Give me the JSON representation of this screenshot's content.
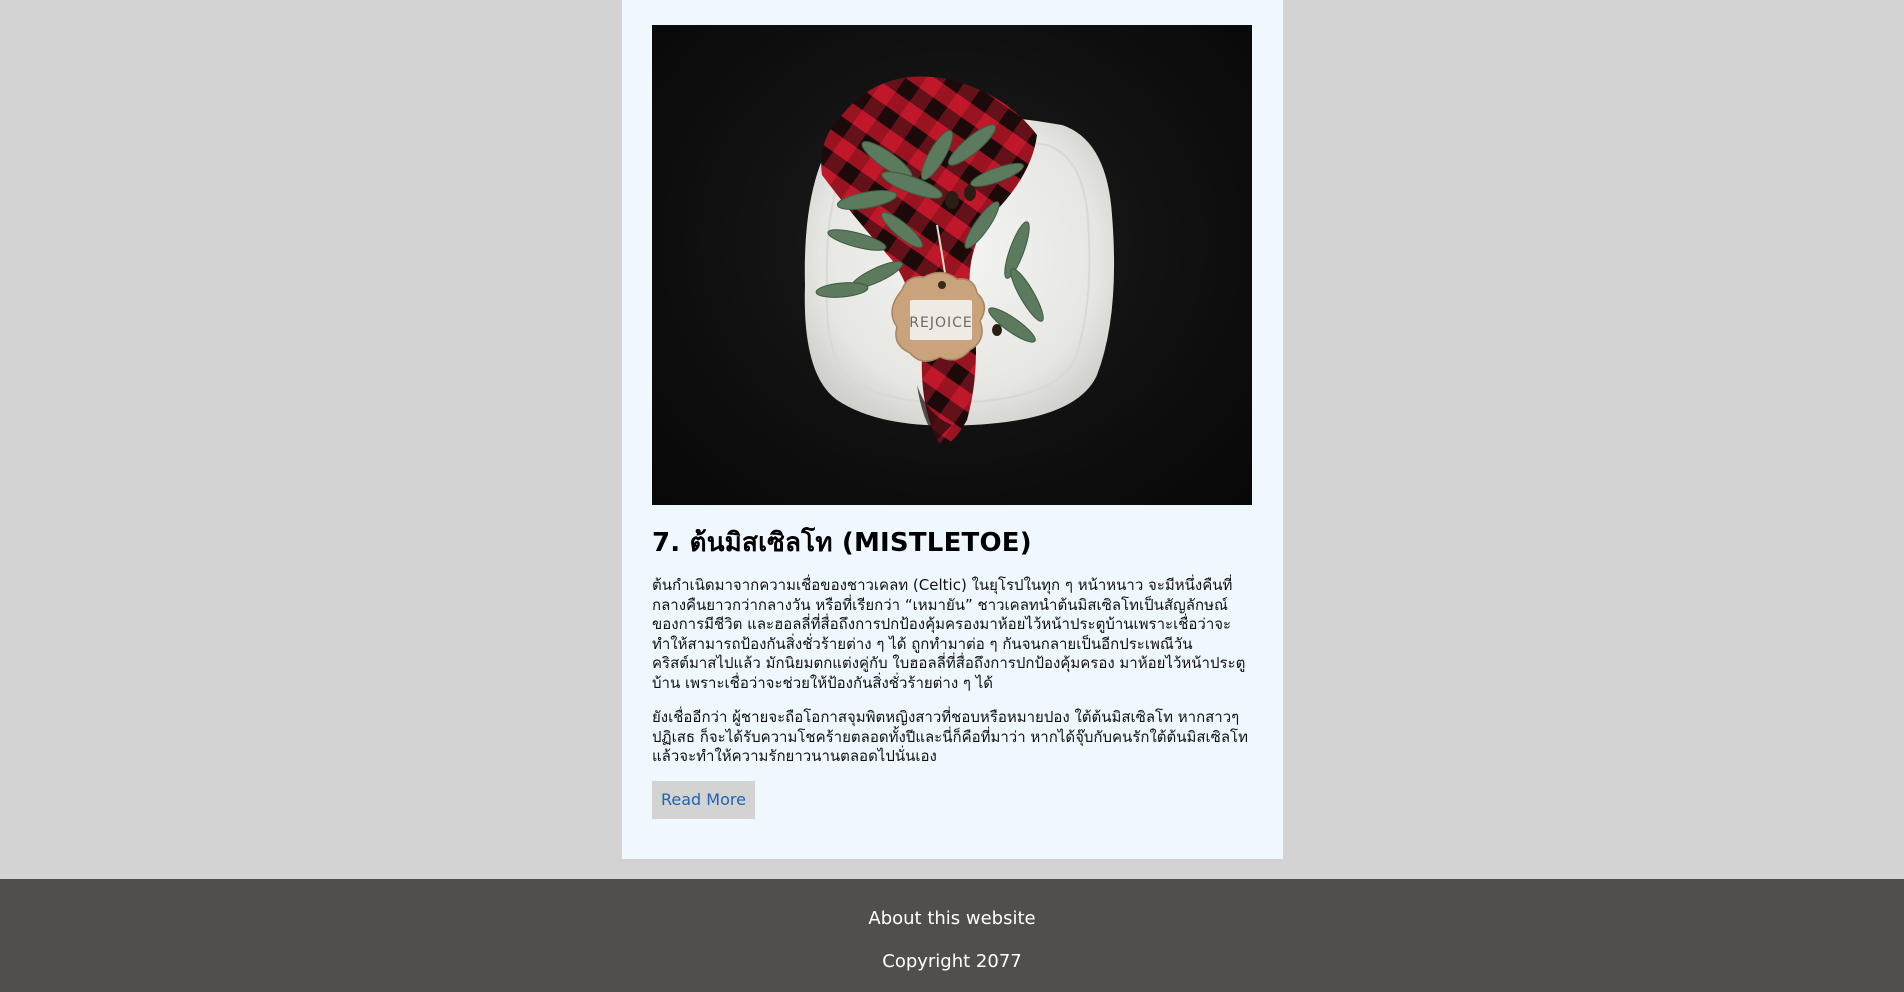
{
  "article": {
    "image": {
      "tag_text": "REJOICE"
    },
    "title": "7. ต้นมิสเซิลโท (MISTLETOE)",
    "paragraph1": "ต้นกำเนิดมาจากความเชื่อของชาวเคลท (Celtic) ในยุโรปในทุก ๆ หน้าหนาว จะมีหนึ่งคืนที่กลางคืนยาวกว่ากลางวัน หรือที่เรียกว่า “เหมายัน” ชาวเคลทนำต้นมิสเซิลโทเป็นสัญลักษณ์ของการมีชีวิต และฮอลลี่ที่สื่อถึงการปกป้องคุ้มครองมาห้อยไว้หน้าประตูบ้านเพราะเชื่อว่าจะทำให้สามารถป้องกันสิ่งชั่วร้ายต่าง ๆ ได้ ถูกทำมาต่อ ๆ กันจนกลายเป็นอีกประเพณีวันคริสต์มาสไปแล้ว มักนิยมตกแต่งคู่กับ ใบฮอลลี่ที่สื่อถึงการปกป้องคุ้มครอง มาห้อยไว้หน้าประตูบ้าน เพราะเชื่อว่าจะช่วยให้ป้องกันสิ่งชั่วร้ายต่าง ๆ ได้",
    "paragraph2": "ยังเชื่ออีกว่า ผู้ชายจะถือโอกาสจุมพิตหญิงสาวที่ชอบหรือหมายปอง ใต้ต้นมิสเซิลโท หากสาวๆ ปฏิเสธ ก็จะได้รับความโชคร้ายตลอดทั้งปีและนี่ก็คือที่มาว่า หากได้จุ๊บกับคนรักใต้ต้นมิสเซิลโทแล้วจะทำให้ความรักยาวนานตลอดไปนั่นเอง",
    "read_more_label": "Read More"
  },
  "footer": {
    "about_link": "About this website",
    "copyright": "Copyright 2077"
  },
  "colors": {
    "page_background": "#d3d3d3",
    "card_background": "#f0f8ff",
    "footer_background": "#514e4c",
    "link_color": "#1f63b0",
    "plaid_red": "#c0182a",
    "leaf_green": "#5b7a5e"
  }
}
